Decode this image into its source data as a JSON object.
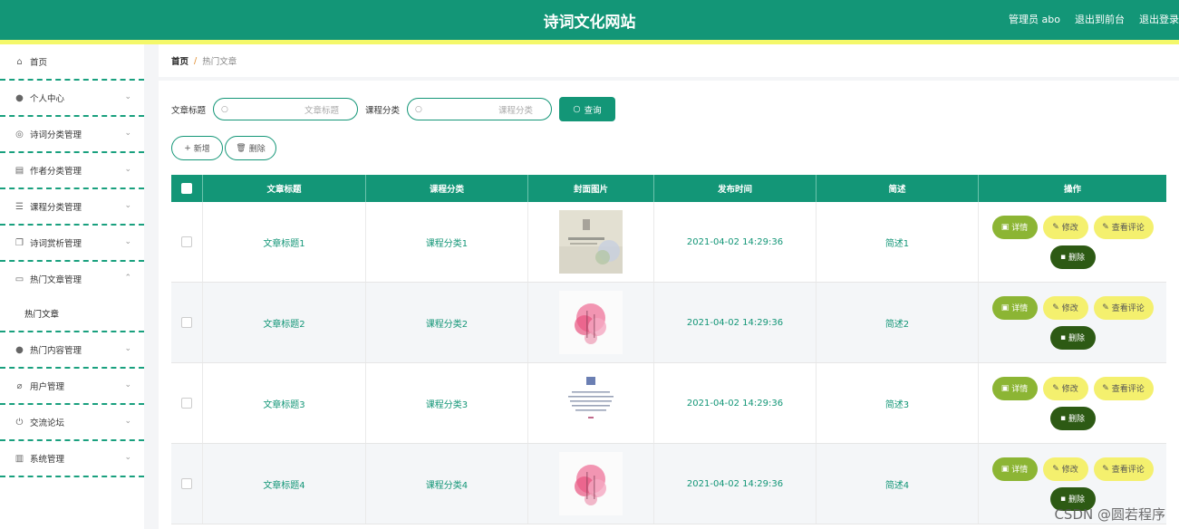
{
  "header": {
    "site_title": "诗词文化网站",
    "admin_label": "管理员 abo",
    "back_front": "退出到前台",
    "logout": "退出登录"
  },
  "sidebar": {
    "items": [
      {
        "label": "首页",
        "icon": "home-icon"
      },
      {
        "label": "个人中心",
        "icon": "user-icon"
      },
      {
        "label": "诗词分类管理",
        "icon": "globe-icon"
      },
      {
        "label": "作者分类管理",
        "icon": "briefcase-icon"
      },
      {
        "label": "课程分类管理",
        "icon": "list-icon"
      },
      {
        "label": "诗词赏析管理",
        "icon": "copy-icon"
      },
      {
        "label": "热门文章管理",
        "icon": "chat-icon"
      },
      {
        "label": "热门内容管理",
        "icon": "user-icon"
      },
      {
        "label": "用户管理",
        "icon": "bell-off-icon"
      },
      {
        "label": "交流论坛",
        "icon": "power-icon"
      },
      {
        "label": "系统管理",
        "icon": "chart-icon"
      }
    ],
    "sub_item": "热门文章"
  },
  "breadcrumb": {
    "home": "首页",
    "sep": "/",
    "current": "热门文章"
  },
  "search": {
    "title_label": "文章标题",
    "title_placeholder": "文章标题",
    "category_label": "课程分类",
    "category_placeholder": "课程分类",
    "query_label": "查询"
  },
  "actions": {
    "add_label": "新增",
    "delete_label": "删除"
  },
  "table": {
    "headers": [
      "文章标题",
      "课程分类",
      "封面图片",
      "发布时间",
      "简述",
      "操作"
    ],
    "rows": [
      {
        "title": "文章标题1",
        "category": "课程分类1",
        "time": "2021-04-02 14:29:36",
        "summary": "简述1",
        "cover": "cover-landscape-flower"
      },
      {
        "title": "文章标题2",
        "category": "课程分类2",
        "time": "2021-04-02 14:29:36",
        "summary": "简述2",
        "cover": "cover-pink-flower"
      },
      {
        "title": "文章标题3",
        "category": "课程分类3",
        "time": "2021-04-02 14:29:36",
        "summary": "简述3",
        "cover": "cover-text-poem"
      },
      {
        "title": "文章标题4",
        "category": "课程分类4",
        "time": "2021-04-02 14:29:36",
        "summary": "简述4",
        "cover": "cover-pink-flower"
      }
    ],
    "ops": {
      "detail": "详情",
      "edit": "修改",
      "comment": "查看评论",
      "delete": "删除"
    }
  },
  "watermark": "CSDN @圆若程序",
  "colors": {
    "primary": "#139677",
    "stripe": "#f4f86a",
    "detail": "#8cb534",
    "edit": "#f4f06e",
    "delete": "#2d5a14"
  }
}
